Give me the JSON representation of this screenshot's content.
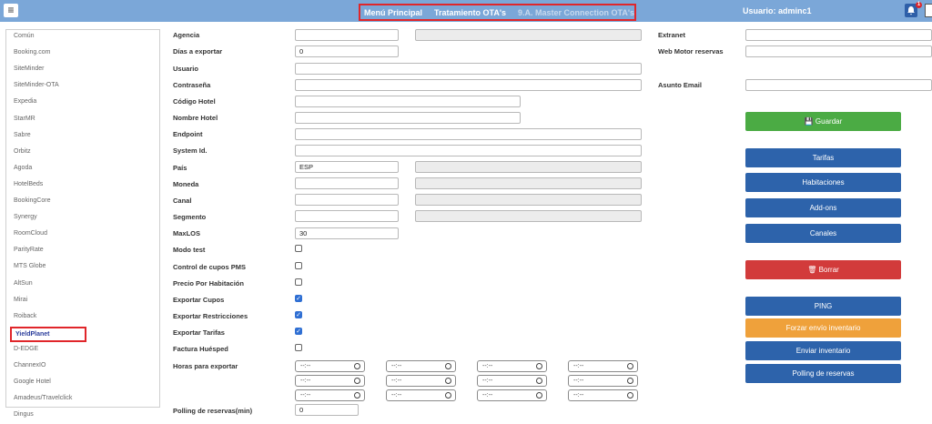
{
  "topbar": {
    "menu_principal": "Menú Principal",
    "tratamiento": "Tratamiento OTA's",
    "master": "9.A. Master Connection OTA's",
    "user": "Usuario: adminc1",
    "notifications": "1"
  },
  "sidebar": {
    "items": [
      "Común",
      "Booking.com",
      "SiteMinder",
      "SiteMinder-OTA",
      "Expedia",
      "StarMR",
      "Sabre",
      "Orbitz",
      "Agoda",
      "HotelBeds",
      "BookingCore",
      "Synergy",
      "RoomCloud",
      "ParityRate",
      "MTS Globe",
      "AltSun",
      "Mirai",
      "Roiback",
      "YieldPlanet",
      "D-EDGE",
      "ChannexIO",
      "Google Hotel",
      "Amadeus/Travelclick",
      "Dingus"
    ],
    "active_index": 18
  },
  "form": {
    "labels": {
      "agencia": "Agencia",
      "dias": "Días a exportar",
      "usuario": "Usuario",
      "contrasena": "Contraseña",
      "codigo": "Código Hotel",
      "nombre": "Nombre Hotel",
      "endpoint": "Endpoint",
      "system": "System Id.",
      "pais": "País",
      "moneda": "Moneda",
      "canal": "Canal",
      "segmento": "Segmento",
      "maxlos": "MaxLOS",
      "modo_test": "Modo test",
      "control_cupos": "Control de cupos PMS",
      "precio_hab": "Precio Por Habitación",
      "exp_cupos": "Exportar Cupos",
      "exp_restr": "Exportar Restricciones",
      "exp_tarifas": "Exportar Tarifas",
      "factura": "Factura Huésped",
      "horas": "Horas para exportar",
      "polling": "Polling de reservas(min)",
      "extranet": "Extranet",
      "web_motor": "Web Motor reservas",
      "asunto": "Asunto Email"
    },
    "values": {
      "dias": "0",
      "pais": "ESP",
      "maxlos": "30",
      "polling": "0",
      "time_placeholder": "--:--"
    },
    "checkboxes": {
      "modo_test": false,
      "control_cupos": false,
      "precio_hab": false,
      "exp_cupos": true,
      "exp_restr": true,
      "exp_tarifas": true,
      "factura": false
    }
  },
  "buttons": {
    "guardar": "Guardar",
    "tarifas": "Tarifas",
    "habitaciones": "Habitaciones",
    "addons": "Add-ons",
    "canales": "Canales",
    "borrar": "Borrar",
    "ping": "PING",
    "forzar": "Forzar envío inventario",
    "enviar": "Enviar inventario",
    "polling": "Polling de reservas"
  },
  "colors": {
    "topbar": "#7ba7d8",
    "green": "#4bab44",
    "blue": "#2d63ab",
    "red": "#d23b3b",
    "orange": "#efa13b"
  }
}
